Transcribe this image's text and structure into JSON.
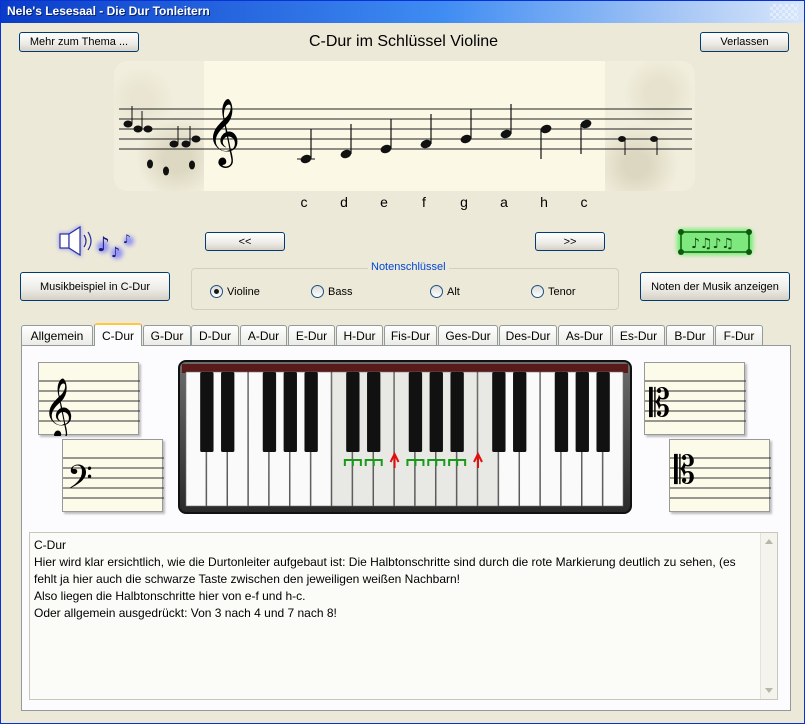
{
  "window": {
    "title": "Nele's Lesesaal - Die Dur Tonleitern"
  },
  "toolbar": {
    "more_label": "Mehr zum Thema ...",
    "heading": "C-Dur im Schlüssel Violine",
    "exit_label": "Verlassen"
  },
  "scale_notes": [
    "c",
    "d",
    "e",
    "f",
    "g",
    "a",
    "h",
    "c"
  ],
  "nav": {
    "prev_label": "<<",
    "next_label": ">>"
  },
  "music_example_label": "Musikbeispiel in C-Dur",
  "show_notes_label": "Noten der Musik anzeigen",
  "clef_group": {
    "legend": "Notenschlüssel",
    "options": [
      "Violine",
      "Bass",
      "Alt",
      "Tenor"
    ],
    "selected": "Violine"
  },
  "tabs": [
    "Allgemein",
    "C-Dur",
    "G-Dur",
    "D-Dur",
    "A-Dur",
    "E-Dur",
    "H-Dur",
    "Fis-Dur",
    "Ges-Dur",
    "Des-Dur",
    "As-Dur",
    "Es-Dur",
    "B-Dur",
    "F-Dur"
  ],
  "active_tab": "C-Dur",
  "description": "C-Dur\nHier wird klar ersichtlich, wie die Durtonleiter aufgebaut ist: Die Halbtonschritte sind durch die rote Markierung deutlich zu sehen, (es fehlt ja hier auch die schwarze Taste zwischen den jeweiligen weißen Nachbarn!\nAlso liegen die Halbtonschritte hier von e-f und h-c.\nOder allgemein ausgedrückt: Von 3 nach 4 und 7 nach 8!",
  "colors": {
    "whole_step": "#1a9a1a",
    "half_step": "#e01010",
    "tab_highlight": "#ffc83c"
  },
  "icons": {
    "speaker": "speaker-notes-icon",
    "scroll": "music-scroll-icon"
  }
}
